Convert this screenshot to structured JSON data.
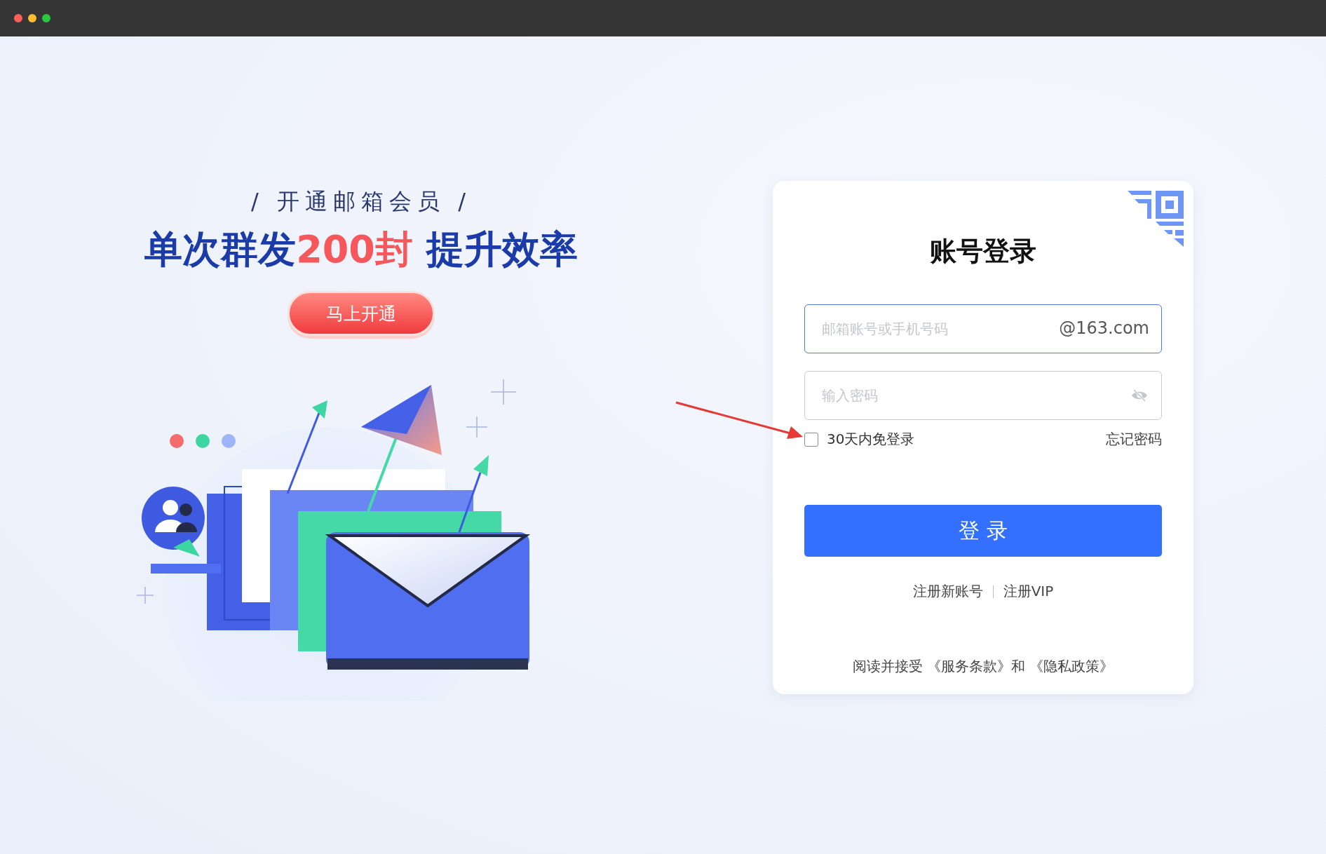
{
  "promo": {
    "subtitle": "/ 开通邮箱会员 /",
    "headline": [
      {
        "text": "单次群发",
        "accent": false
      },
      {
        "text": "200封",
        "accent": true
      },
      {
        "text": " 提升效率",
        "accent": false
      }
    ],
    "button": "马上开通"
  },
  "login": {
    "title": "账号登录",
    "account": {
      "placeholder": "邮箱账号或手机号码",
      "suffix": "@163.com"
    },
    "password": {
      "placeholder": "输入密码"
    },
    "remember": {
      "label": "30天内免登录",
      "checked": false
    },
    "forgot": "忘记密码",
    "submit": "登 录",
    "links": [
      "注册新账号",
      "注册VIP"
    ],
    "agreement": {
      "before": "阅读并接受",
      "terms": "《服务条款》",
      "joiner": "和",
      "privacy": "《隐私政策》"
    }
  }
}
